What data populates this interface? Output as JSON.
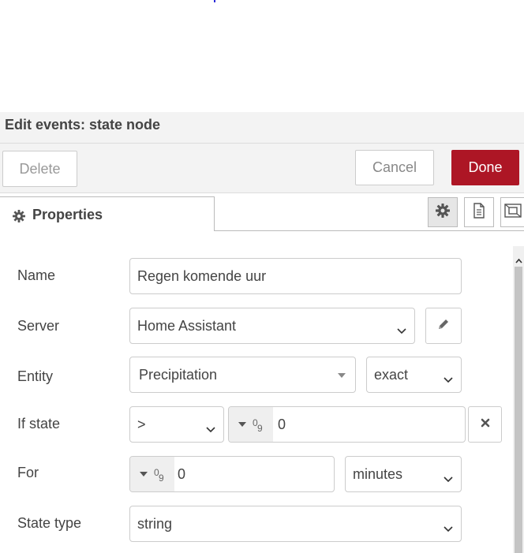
{
  "dialog": {
    "title": "Edit events: state node"
  },
  "toolbar": {
    "delete_label": "Delete",
    "cancel_label": "Cancel",
    "done_label": "Done",
    "done_color": "#ad1625"
  },
  "tabs": {
    "properties_label": "Properties",
    "icons": [
      "gear-icon",
      "description-icon",
      "appearance-icon"
    ]
  },
  "form": {
    "name": {
      "label": "Name",
      "value": "Regen komende uur"
    },
    "server": {
      "label": "Server",
      "value": "Home Assistant"
    },
    "entity": {
      "label": "Entity",
      "value": "Precipitation",
      "match": "exact"
    },
    "if_state": {
      "label": "If state",
      "operator": ">",
      "value": "0",
      "type_superscript": "0",
      "type_subscript": "9"
    },
    "for": {
      "label": "For",
      "value": "0",
      "unit": "minutes",
      "type_superscript": "0",
      "type_subscript": "9"
    },
    "state_type": {
      "label": "State type",
      "value": "string"
    }
  }
}
